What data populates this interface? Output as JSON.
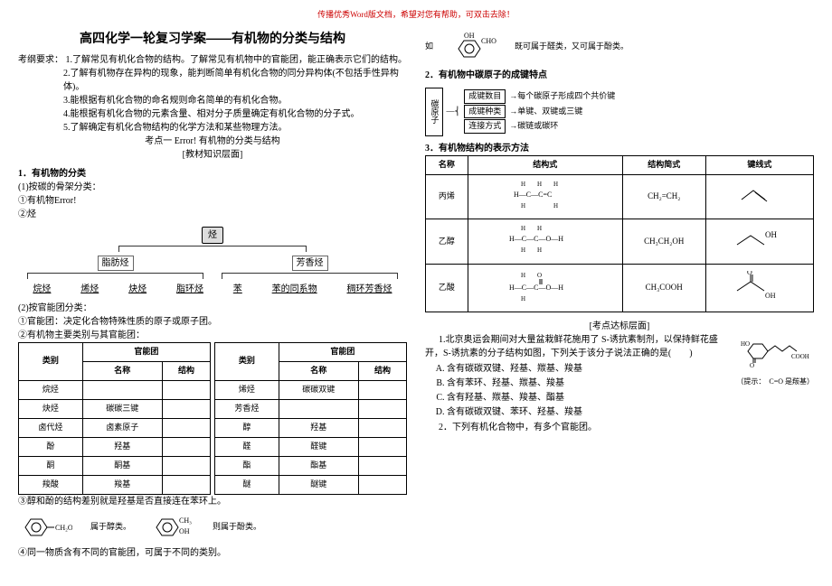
{
  "header_note": "传播优秀Word版文档，希望对您有帮助，可双击去除！",
  "title": "高四化学一轮复习学案——有机物的分类与结构",
  "req_label": "考纲要求：",
  "requirements": [
    "1.了解常见有机化合物的结构。了解常见有机物中的官能团，能正确表示它们的结构。",
    "2.了解有机物存在异构的现象，能判断简单有机化合物的同分异构体(不包括手性异构体)。",
    "3.能根据有机化合物的命名规则命名简单的有机化合物。",
    "4.能根据有机化合物的元素含量、相对分子质量确定有机化合物的分子式。",
    "5.了解确定有机化合物结构的化学方法和某些物理方法。"
  ],
  "kaodian1": "考点一 Error! 有机物的分类与结构",
  "layer1": "[教材知识层面]",
  "sec1_title": "1．有机物的分类",
  "sec1_1": "(1)按碳的骨架分类：",
  "sec1_1a": "①有机物Error!",
  "sec1_1b": "②烃",
  "tree": {
    "top": "烃",
    "mid_left": "脂肪烃",
    "mid_right": "芳香烃",
    "bottom": [
      "烷烃",
      "烯烃",
      "炔烃",
      "脂环烃",
      "苯",
      "苯的同系物",
      "稠环芳香烃"
    ]
  },
  "sec1_2": "(2)按官能团分类：",
  "sec1_2a": "①官能团：决定化合物特殊性质的原子或原子团。",
  "sec1_2b": "②有机物主要类别与其官能团：",
  "func_table": {
    "headers": {
      "cat": "类别",
      "grp": "官能团",
      "name": "名称",
      "struct": "结构"
    },
    "left": [
      {
        "cat": "烷烃",
        "name": "",
        "struct": ""
      },
      {
        "cat": "炔烃",
        "name": "碳碳三键",
        "struct": ""
      },
      {
        "cat": "卤代烃",
        "name": "卤素原子",
        "struct": ""
      },
      {
        "cat": "酚",
        "name": "羟基",
        "struct": ""
      },
      {
        "cat": "酮",
        "name": "酮基",
        "struct": ""
      },
      {
        "cat": "羧酸",
        "name": "羧基",
        "struct": ""
      }
    ],
    "right": [
      {
        "cat": "烯烃",
        "name": "碳碳双键",
        "struct": ""
      },
      {
        "cat": "芳香烃",
        "name": "",
        "struct": ""
      },
      {
        "cat": "醇",
        "name": "羟基",
        "struct": ""
      },
      {
        "cat": "醛",
        "name": "醛键",
        "struct": ""
      },
      {
        "cat": "酯",
        "name": "酯基",
        "struct": ""
      },
      {
        "cat": "醚",
        "name": "醚键",
        "struct": ""
      }
    ]
  },
  "sec1_3": "③醇和酚的结构差别就是羟基是否直接连在苯环上。",
  "mol_labels": {
    "a": "属于醇类。",
    "b": "则属于酚类。"
  },
  "sec1_4": "④同一物质含有不同的官能团，可属于不同的类别。",
  "right_top": "既可属于醛类，又可属于酚类。",
  "right_prefix": "如",
  "sec2_title": "2．有机物中碳原子的成键特点",
  "carbon": {
    "label": "碳原子",
    "r1a": "成键数目",
    "r1b": "每个碳原子形成四个共价键",
    "r2a": "成键种类",
    "r2b": "单键、双键或三键",
    "r3a": "连接方式",
    "r3b": "碳链或碳环"
  },
  "sec3_title": "3．有机物结构的表示方法",
  "methods": {
    "headers": {
      "name": "名称",
      "full": "结构式",
      "short": "结构简式",
      "line": "键线式"
    },
    "rows": [
      {
        "name": "丙烯",
        "short": "CH₂=CH₂"
      },
      {
        "name": "乙醇",
        "short": "CH₃CH₂OH"
      },
      {
        "name": "乙酸",
        "short": "CH₃COOH"
      }
    ]
  },
  "layer2": "[考点达标层面]",
  "q1": "1.北京奥运会期间对大量盆栽鲜花施用了 S-诱抗素制剂，以保持鲜花盛开，S-诱抗素的分子结构如图，下列关于该分子说法正确的是(　　)",
  "q1_opts": [
    "含有碳碳双键、羟基、羰基、羧基",
    "含有苯环、羟基、羰基、羧基",
    "含有羟基、羰基、羧基、酯基",
    "含有碳碳双键、苯环、羟基、羧基"
  ],
  "q1_hint": "（提示：　C=O 是羰基）",
  "q2": "2．下列有机化合物中，有多个官能团。"
}
